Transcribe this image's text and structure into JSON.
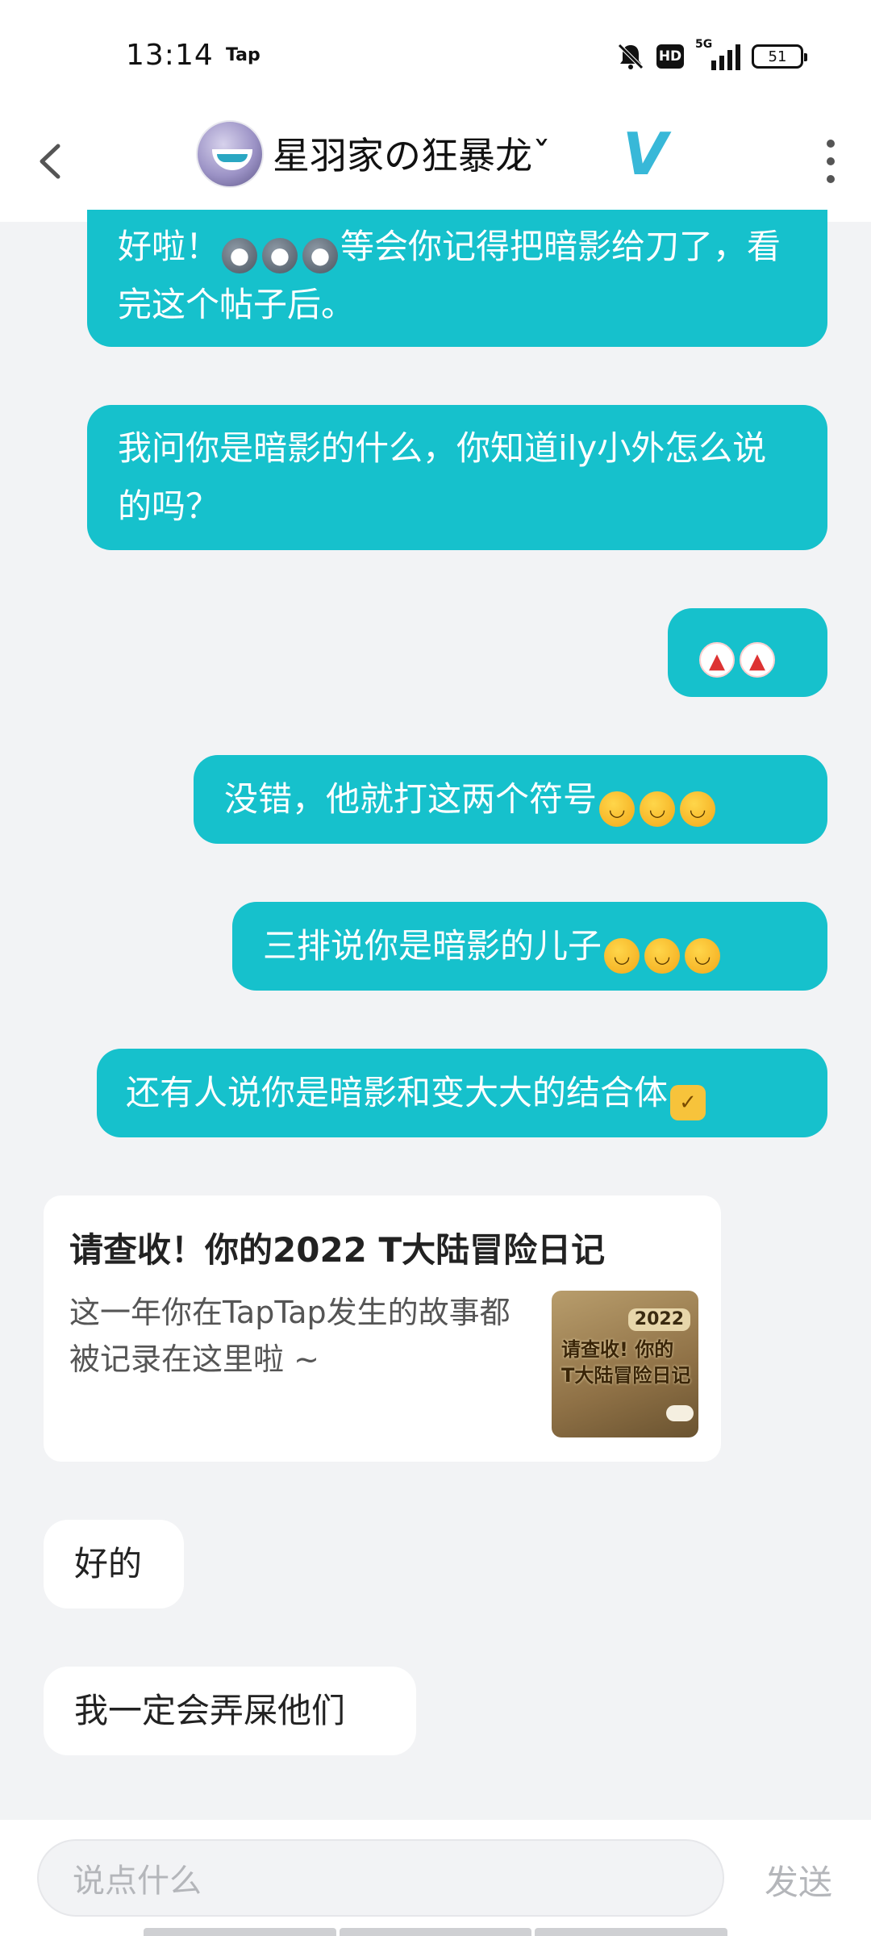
{
  "status_bar": {
    "time": "13:14",
    "app_label": "Tap",
    "network": "5G",
    "hd": "HD",
    "battery": "51"
  },
  "header": {
    "title": "星羽家の狂暴龙ˇ",
    "badge": "V"
  },
  "messages": [
    {
      "side": "out",
      "parts": [
        "好啦！",
        "等会你记得把暗影给刀了，看完这个帖子后。"
      ],
      "emoji": [
        "moon",
        "moon",
        "moon"
      ]
    },
    {
      "side": "out",
      "text": "我问你是暗影的什么，你知道ily小外怎么说的吗？"
    },
    {
      "side": "out",
      "emoji": [
        "chicken",
        "chicken"
      ]
    },
    {
      "side": "out",
      "text": "没错，他就打这两个符号",
      "emoji": [
        "rofl",
        "rofl",
        "rofl"
      ]
    },
    {
      "side": "out",
      "text": "三排说你是暗影的儿子",
      "emoji": [
        "rofl",
        "rofl",
        "rofl"
      ]
    },
    {
      "side": "out",
      "text": "还有人说你是暗影和变大大的结合体",
      "emoji": [
        "thumbs-up"
      ]
    },
    {
      "side": "in",
      "type": "card",
      "card": {
        "title": "请查收！你的2022 T大陆冒险日记",
        "description": "这一年你在TapTap发生的故事都被记录在这里啦 ~",
        "thumb_year": "2022",
        "thumb_line1": "请查收! 你的",
        "thumb_line2": "T大陆冒险日记"
      }
    },
    {
      "side": "in",
      "text": "好的"
    },
    {
      "side": "in",
      "text": "我一定会弄屎他们"
    }
  ],
  "input": {
    "placeholder": "说点什么",
    "send_label": "发送"
  },
  "colors": {
    "outgoing_bubble": "#16c1cc",
    "incoming_bubble": "#ffffff",
    "background": "#f2f3f5",
    "verified_badge": "#38b8d8"
  }
}
